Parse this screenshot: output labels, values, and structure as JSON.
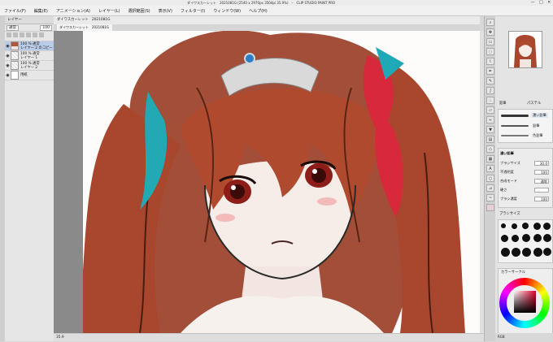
{
  "window": {
    "title": "ダイワスカーレット　2021081G (2540 x 2970px 350dpi 35.9%)　–　CLIP STUDIO PAINT PRO",
    "controls": [
      "—",
      "□",
      "✕"
    ]
  },
  "menu": [
    "ファイル(F)",
    "編集(E)",
    "アニメーション(A)",
    "レイヤー(L)",
    "選択範囲(S)",
    "表示(V)",
    "フィルター(I)",
    "ウィンドウ(W)",
    "ヘルプ(H)"
  ],
  "layer_panel": {
    "tab": "レイヤー",
    "blend_mode": "通常",
    "opacity": "100",
    "layers": [
      {
        "pct": "100 %  通常",
        "name": "レイヤー 2 のコピー",
        "selected": true,
        "thumb": "art"
      },
      {
        "pct": "100 %  通常",
        "name": "レイヤー 1",
        "selected": false,
        "thumb": "grid"
      },
      {
        "pct": "100 %  通常",
        "name": "レイヤー 2",
        "selected": false,
        "thumb": "grid"
      },
      {
        "pct": "",
        "name": "用紙",
        "selected": false,
        "thumb": "paper"
      }
    ]
  },
  "document": {
    "info": "ダイワスカーレット　2021081G",
    "tab_label": "ダイワスカーレット　2021081G",
    "zoom_status": "35.9"
  },
  "brush_panel": {
    "tabs": [
      "鉛筆",
      "パステル"
    ],
    "brushes": [
      "濃い鉛筆",
      "鉛筆",
      "色鉛筆"
    ],
    "selected_brush": "濃い鉛筆"
  },
  "tool_property": {
    "title": "濃い鉛筆",
    "rows": [
      {
        "label": "ブラシサイズ",
        "value": "30.0"
      },
      {
        "label": "不透明度",
        "value": "100"
      },
      {
        "label": "合成モード",
        "value": "通常"
      },
      {
        "label": "硬さ",
        "value": ""
      },
      {
        "label": "ブラシ濃度",
        "value": "100"
      }
    ]
  },
  "brush_tips": {
    "title": "ブラシサイズ"
  },
  "color_panel": {
    "title": "カラーサークル",
    "accent": "#e3002d"
  },
  "status": {
    "right": "RGB"
  }
}
